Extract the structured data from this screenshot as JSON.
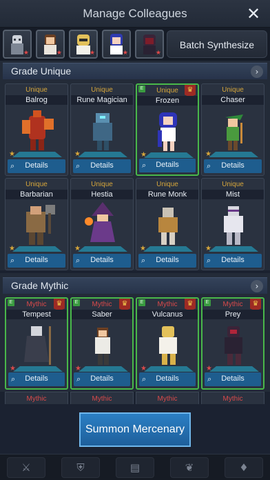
{
  "header": {
    "title": "Manage Colleagues"
  },
  "batch_button": "Batch Synthesize",
  "grades": [
    {
      "label": "Grade Unique",
      "cards": [
        {
          "grade": "Unique",
          "name": "Balrog",
          "details": "Details"
        },
        {
          "grade": "Unique",
          "name": "Rune Magician",
          "details": "Details"
        },
        {
          "grade": "Unique",
          "name": "Frozen",
          "details": "Details"
        },
        {
          "grade": "Unique",
          "name": "Chaser",
          "details": "Details"
        },
        {
          "grade": "Unique",
          "name": "Barbarian",
          "details": "Details"
        },
        {
          "grade": "Unique",
          "name": "Hestia",
          "details": "Details"
        },
        {
          "grade": "Unique",
          "name": "Rune Monk",
          "details": "Details"
        },
        {
          "grade": "Unique",
          "name": "Mist",
          "details": "Details"
        }
      ]
    },
    {
      "label": "Grade Mythic",
      "cards": [
        {
          "grade": "Mythic",
          "name": "Tempest",
          "details": "Details"
        },
        {
          "grade": "Mythic",
          "name": "Saber",
          "details": "Details"
        },
        {
          "grade": "Mythic",
          "name": "Vulcanus",
          "details": "Details"
        },
        {
          "grade": "Mythic",
          "name": "Prey",
          "details": "Details"
        }
      ]
    }
  ],
  "partial_row": [
    "Mythic",
    "Mythic",
    "Mythic",
    "Mythic"
  ],
  "summon_button": "Summon Mercenary",
  "colors": {
    "accent": "#1e5d8e",
    "unique": "#d7a73b",
    "mythic": "#d94a4a",
    "selected": "#49b84a"
  },
  "icons": {
    "close": "close-icon",
    "arrow": "chevron-right-icon",
    "search": "search-icon"
  }
}
